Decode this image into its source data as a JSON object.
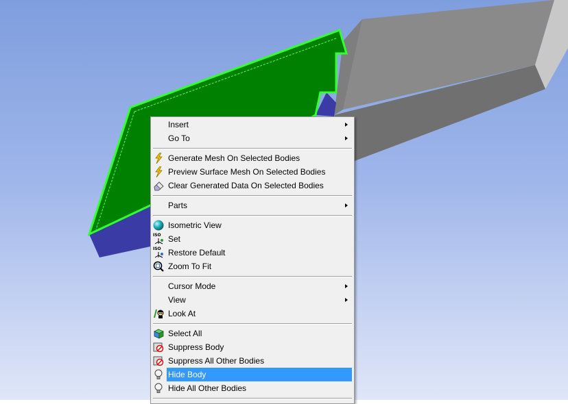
{
  "menu": {
    "items": [
      {
        "label": "Insert",
        "submenu": true,
        "icon": ""
      },
      {
        "label": "Go To",
        "submenu": true,
        "icon": ""
      },
      {
        "separator": true
      },
      {
        "label": "Generate Mesh On Selected Bodies",
        "icon": "lightning-icon"
      },
      {
        "label": "Preview Surface Mesh On Selected Bodies",
        "icon": "lightning-icon"
      },
      {
        "label": "Clear Generated Data On Selected Bodies",
        "icon": "eraser-icon"
      },
      {
        "separator": true
      },
      {
        "label": "Parts",
        "submenu": true,
        "icon": ""
      },
      {
        "separator": true
      },
      {
        "label": "Isometric View",
        "icon": "sphere-icon"
      },
      {
        "label": "Set",
        "icon": "iso-set-icon"
      },
      {
        "label": "Restore Default",
        "icon": "iso-restore-icon"
      },
      {
        "label": "Zoom To Fit",
        "icon": "zoom-fit-icon"
      },
      {
        "separator": true
      },
      {
        "label": "Cursor Mode",
        "submenu": true,
        "icon": ""
      },
      {
        "label": "View",
        "submenu": true,
        "icon": ""
      },
      {
        "label": "Look At",
        "icon": "look-at-icon"
      },
      {
        "separator": true
      },
      {
        "label": "Select All",
        "icon": "select-all-icon"
      },
      {
        "label": "Suppress Body",
        "icon": "suppress-icon"
      },
      {
        "label": "Suppress All Other Bodies",
        "icon": "suppress-icon"
      },
      {
        "label": "Hide Body",
        "icon": "lightbulb-icon",
        "highlighted": true
      },
      {
        "label": "Hide All Other Bodies",
        "icon": "lightbulb-icon"
      }
    ]
  },
  "iso_text": "ISO",
  "colors": {
    "viewport_top": "#7f9ede",
    "viewport_bottom": "#dfe6f8",
    "selected_body": "#008000",
    "selected_edge": "#33ff33",
    "body_side": "#3a3aa0",
    "gray_body": "#8c8c8c",
    "highlight": "#3399ff"
  }
}
